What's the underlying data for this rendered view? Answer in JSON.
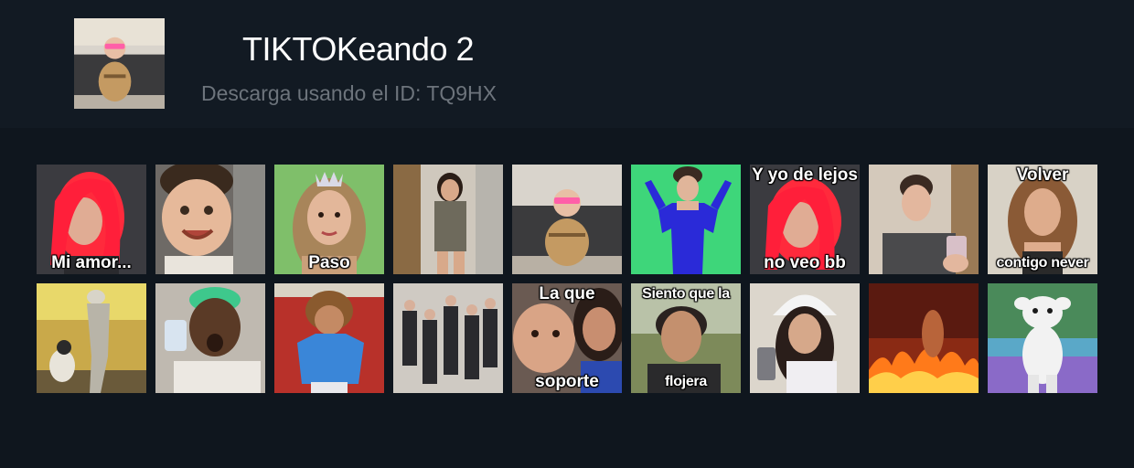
{
  "pack": {
    "title": "TIKTOKeando 2",
    "subtitle": "Descarga usando el ID: TQ9HX"
  },
  "colors": {
    "header_bg": "#121a23",
    "body_bg": "#0f161e",
    "title": "#ffffff",
    "subtitle": "#6d747c"
  },
  "stickers": [
    {
      "top": "",
      "bottom": "Mi amor..."
    },
    {
      "top": "",
      "bottom": ""
    },
    {
      "top": "",
      "bottom": "Paso"
    },
    {
      "top": "",
      "bottom": ""
    },
    {
      "top": "",
      "bottom": ""
    },
    {
      "top": "",
      "bottom": ""
    },
    {
      "top": "Y yo de lejos",
      "bottom": "no veo bb"
    },
    {
      "top": "",
      "bottom": ""
    },
    {
      "top": "Volver",
      "bottom": "contigo never"
    },
    {
      "top": "",
      "bottom": ""
    },
    {
      "top": "",
      "bottom": ""
    },
    {
      "top": "",
      "bottom": ""
    },
    {
      "top": "",
      "bottom": ""
    },
    {
      "top": "La que",
      "bottom": "soporte"
    },
    {
      "top": "Siento que la",
      "bottom": "flojera"
    },
    {
      "top": "",
      "bottom": ""
    },
    {
      "top": "",
      "bottom": ""
    },
    {
      "top": "",
      "bottom": ""
    }
  ]
}
